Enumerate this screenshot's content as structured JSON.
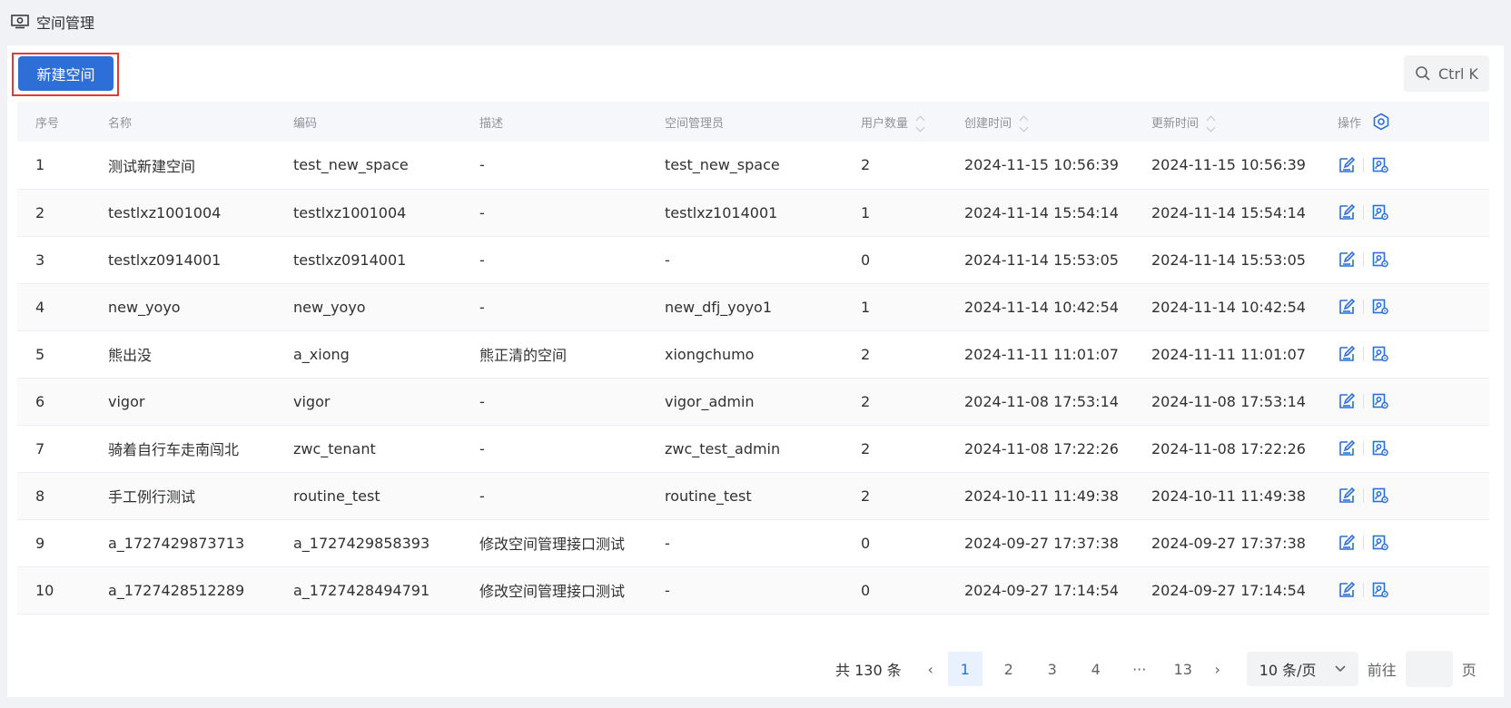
{
  "page": {
    "title": "空间管理"
  },
  "toolbar": {
    "new_label": "新建空间",
    "search_hint": "Ctrl K"
  },
  "table": {
    "headers": [
      "序号",
      "名称",
      "编码",
      "描述",
      "空间管理员",
      "用户数量",
      "创建时间",
      "更新时间",
      "操作"
    ],
    "rows": [
      [
        "1",
        "测试新建空间",
        "test_new_space",
        "-",
        "test_new_space",
        "2",
        "2024-11-15 10:56:39",
        "2024-11-15 10:56:39"
      ],
      [
        "2",
        "testlxz1001004",
        "testlxz1001004",
        "-",
        "testlxz1014001",
        "1",
        "2024-11-14 15:54:14",
        "2024-11-14 15:54:14"
      ],
      [
        "3",
        "testlxz0914001",
        "testlxz0914001",
        "-",
        "-",
        "0",
        "2024-11-14 15:53:05",
        "2024-11-14 15:53:05"
      ],
      [
        "4",
        "new_yoyo",
        "new_yoyo",
        "-",
        "new_dfj_yoyo1",
        "1",
        "2024-11-14 10:42:54",
        "2024-11-14 10:42:54"
      ],
      [
        "5",
        "熊出没",
        "a_xiong",
        "熊正清的空间",
        "xiongchumo",
        "2",
        "2024-11-11 11:01:07",
        "2024-11-11 11:01:07"
      ],
      [
        "6",
        "vigor",
        "vigor",
        "-",
        "vigor_admin",
        "2",
        "2024-11-08 17:53:14",
        "2024-11-08 17:53:14"
      ],
      [
        "7",
        "骑着自行车走南闯北",
        "zwc_tenant",
        "-",
        "zwc_test_admin",
        "2",
        "2024-11-08 17:22:26",
        "2024-11-08 17:22:26"
      ],
      [
        "8",
        "手工例行测试",
        "routine_test",
        "-",
        "routine_test",
        "2",
        "2024-10-11 11:49:38",
        "2024-10-11 11:49:38"
      ],
      [
        "9",
        "a_1727429873713",
        "a_1727429858393",
        "修改空间管理接口测试",
        "-",
        "0",
        "2024-09-27 17:37:38",
        "2024-09-27 17:37:38"
      ],
      [
        "10",
        "a_1727428512289",
        "a_1727428494791",
        "修改空间管理接口测试",
        "-",
        "0",
        "2024-09-27 17:14:54",
        "2024-09-27 17:14:54"
      ]
    ]
  },
  "pagination": {
    "total": "共 130 条",
    "pages": [
      "1",
      "2",
      "3",
      "4",
      "···",
      "13"
    ],
    "current": "1",
    "page_size": "10 条/页",
    "goto_label": "前往",
    "page_unit": "页"
  },
  "colors": {
    "primary": "#2d6fd6",
    "highlight_border": "#e53935"
  }
}
